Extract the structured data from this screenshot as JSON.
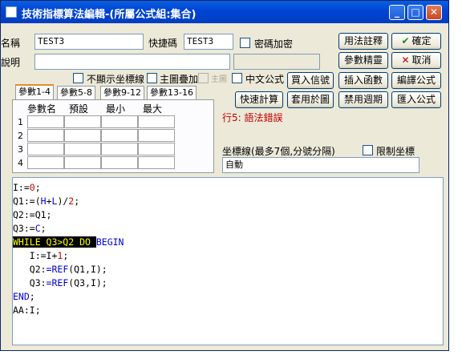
{
  "window": {
    "title": "技術指標算法編輯-(所屬公式組:集合)"
  },
  "titlebar": {
    "minimize": "_",
    "maximize": "□",
    "close": "✕"
  },
  "form": {
    "name_label": "名稱",
    "name_value": "TEST3",
    "shortcut_label": "快捷碼",
    "shortcut_value": "TEST3",
    "password_label": "密碼加密",
    "desc_label": "說明",
    "desc_value": "",
    "hide_axis_label": "不顯示坐標線",
    "overlay_label": "主圖疊加",
    "main_label": "主圖",
    "chinese_label": "中文公式"
  },
  "buttons": {
    "usage": "用法註釋",
    "ok": "確定",
    "param_wizard": "參數精靈",
    "cancel": "取消",
    "buy_signal": "買入信號",
    "insert_func": "插入函數",
    "compile": "編譯公式",
    "quick_calc": "快速計算",
    "apply_chart": "套用於圖",
    "disable_period": "禁用週期",
    "import": "匯入公式"
  },
  "tabs": [
    "參數1-4",
    "參數5-8",
    "參數9-12",
    "參數13-16"
  ],
  "params": {
    "headers": [
      "參數名",
      "預設",
      "最小",
      "最大"
    ],
    "rows": [
      "1",
      "2",
      "3",
      "4"
    ]
  },
  "status": {
    "error": "行5: 語法錯誤"
  },
  "axis": {
    "label": "坐標線(最多7個,分號分隔)",
    "limit_label": "限制坐標",
    "value": "自動"
  },
  "icons": {
    "ok": "check-icon",
    "cancel": "x-icon"
  }
}
